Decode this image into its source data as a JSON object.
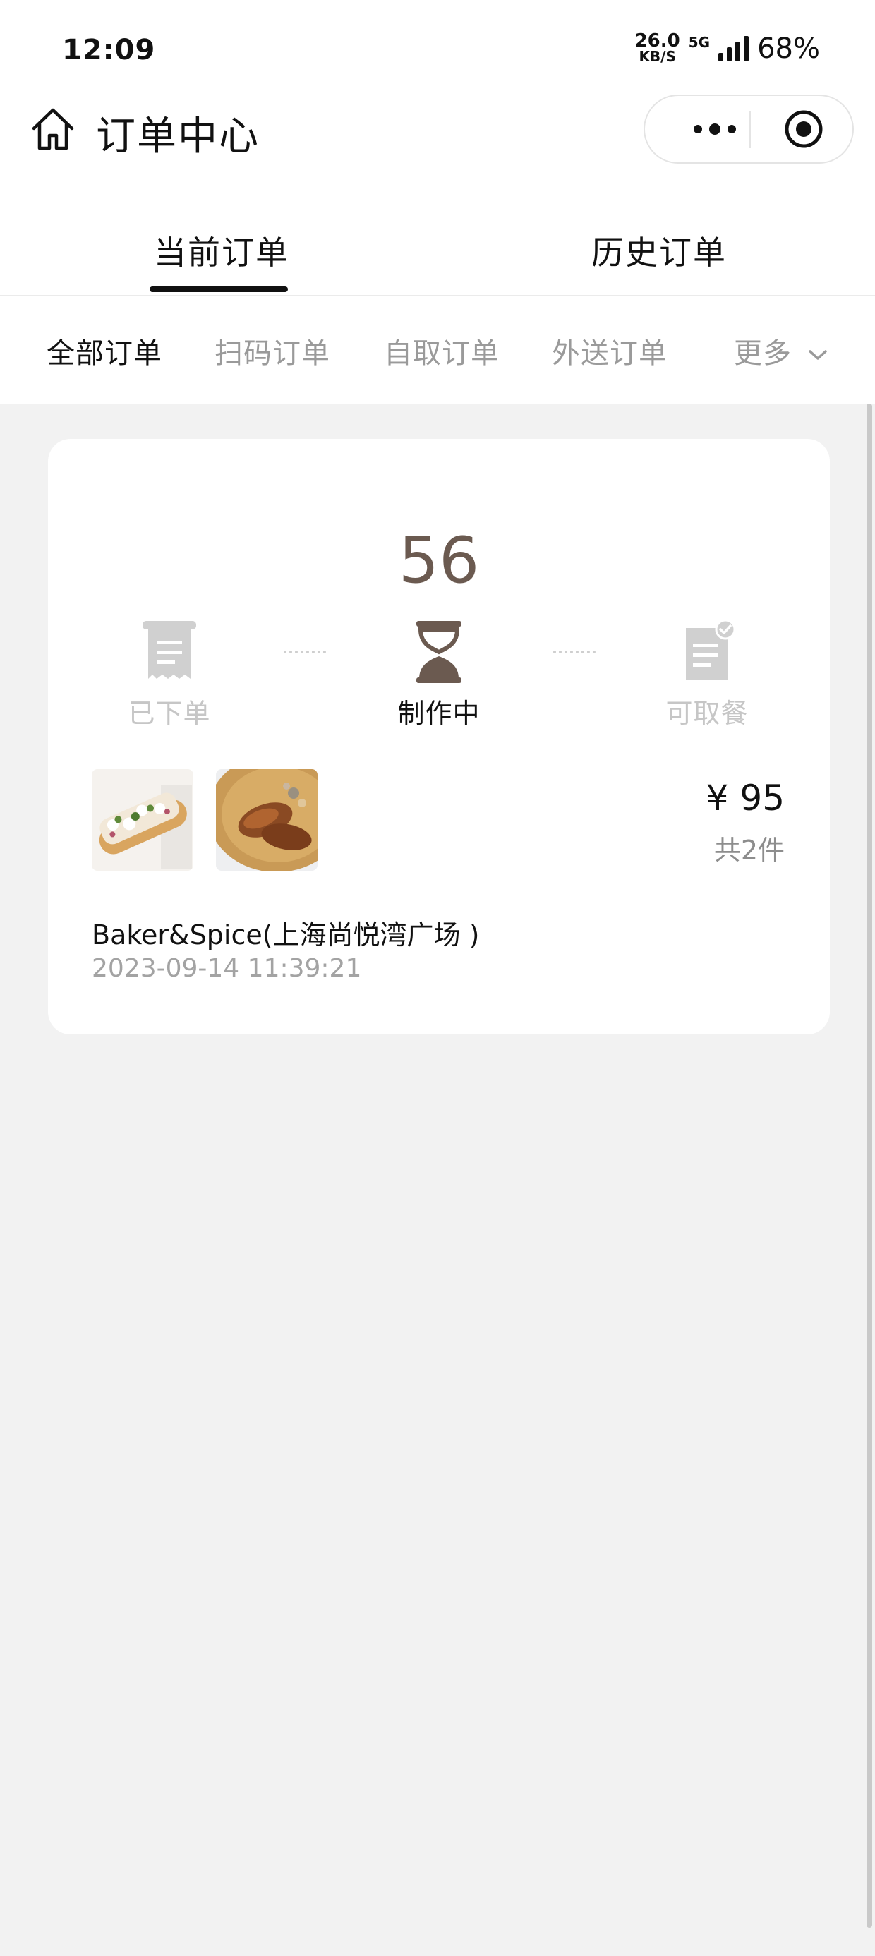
{
  "status_bar": {
    "time": "12:09",
    "net_speed": "26.0",
    "net_unit": "KB/S",
    "network": "5G",
    "battery": "68%"
  },
  "nav": {
    "title": "订单中心",
    "home_icon": "home-icon",
    "more_icon": "more-dots-icon",
    "close_icon": "target-circle-icon"
  },
  "main_tabs": [
    {
      "label": "当前订单",
      "active": true
    },
    {
      "label": "历史订单",
      "active": false
    }
  ],
  "filters": [
    {
      "label": "全部订单",
      "active": true
    },
    {
      "label": "扫码订单",
      "active": false
    },
    {
      "label": "自取订单",
      "active": false
    },
    {
      "label": "外送订单",
      "active": false
    },
    {
      "label": "更多",
      "active": false
    }
  ],
  "order": {
    "pickup_number": "56",
    "steps": [
      {
        "label": "已下单",
        "icon": "receipt-icon",
        "state": "done"
      },
      {
        "label": "制作中",
        "icon": "hourglass-icon",
        "state": "current"
      },
      {
        "label": "可取餐",
        "icon": "ready-document-icon",
        "state": "pending"
      }
    ],
    "price": "¥ 95",
    "item_count": "共2件",
    "store": "Baker&Spice(上海尚悦湾广场 )",
    "time": "2023-09-14 11:39:21",
    "items": [
      {
        "image": "toast-plate-image"
      },
      {
        "image": "roast-chicken-plate-image"
      }
    ]
  },
  "colors": {
    "accent": "#6b5a50",
    "background": "#f2f2f2",
    "inactive": "#c6c6c6"
  }
}
